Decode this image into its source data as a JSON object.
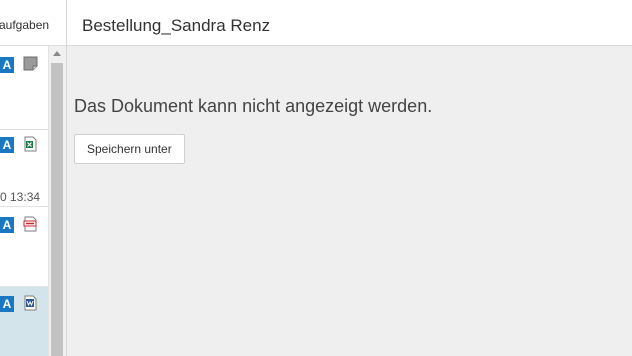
{
  "sidebar": {
    "header_label": "aufgaben",
    "items": [
      {
        "badge": "A",
        "icon": "generic-file-icon"
      },
      {
        "badge": "A",
        "icon": "excel-file-icon"
      },
      {
        "badge": "A",
        "icon": "pdf-file-icon",
        "timestamp": "0 13:34"
      },
      {
        "badge": "A",
        "icon": "word-file-icon"
      }
    ]
  },
  "document": {
    "title": "Bestellung_Sandra Renz",
    "message": "Das Dokument kann nicht angezeigt werden.",
    "save_as_label": "Speichern unter"
  },
  "colors": {
    "badge_blue": "#1a78c2",
    "selected_row": "#d3e4ea",
    "content_bg": "#efefef",
    "excel_green": "#1d7a45",
    "pdf_red": "#c8262f",
    "word_blue": "#2b5797"
  }
}
